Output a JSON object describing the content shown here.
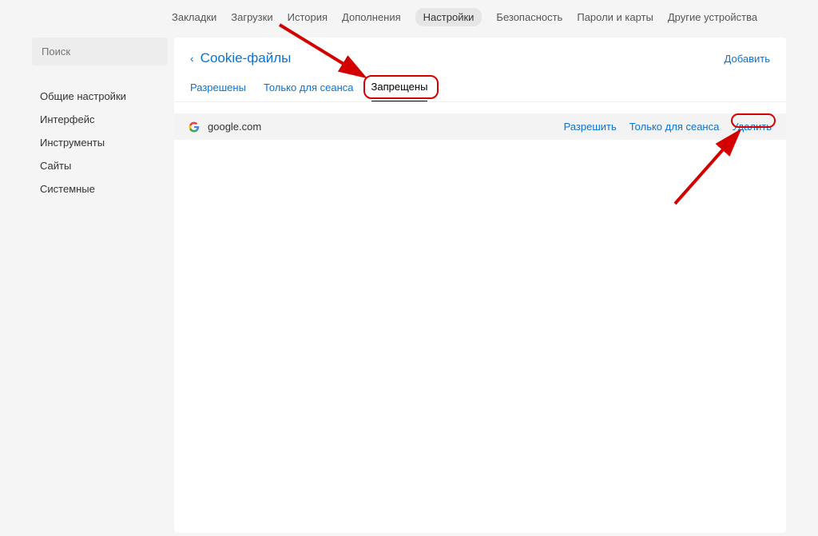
{
  "top_tabs": {
    "bookmarks": "Закладки",
    "downloads": "Загрузки",
    "history": "История",
    "addons": "Дополнения",
    "settings": "Настройки",
    "security": "Безопасность",
    "passwords": "Пароли и карты",
    "other_devices": "Другие устройства"
  },
  "sidebar": {
    "search_placeholder": "Поиск",
    "items": {
      "general": "Общие настройки",
      "interface": "Интерфейс",
      "tools": "Инструменты",
      "sites": "Сайты",
      "system": "Системные"
    }
  },
  "main": {
    "title": "Cookie-файлы",
    "back_chevron": "‹",
    "add_label": "Добавить",
    "subtabs": {
      "allowed": "Разрешены",
      "session": "Только для сеанса",
      "blocked": "Запрещены"
    },
    "row": {
      "domain": "google.com",
      "actions": {
        "allow": "Разрешить",
        "session": "Только для сеанса",
        "delete": "Удалить"
      }
    }
  }
}
